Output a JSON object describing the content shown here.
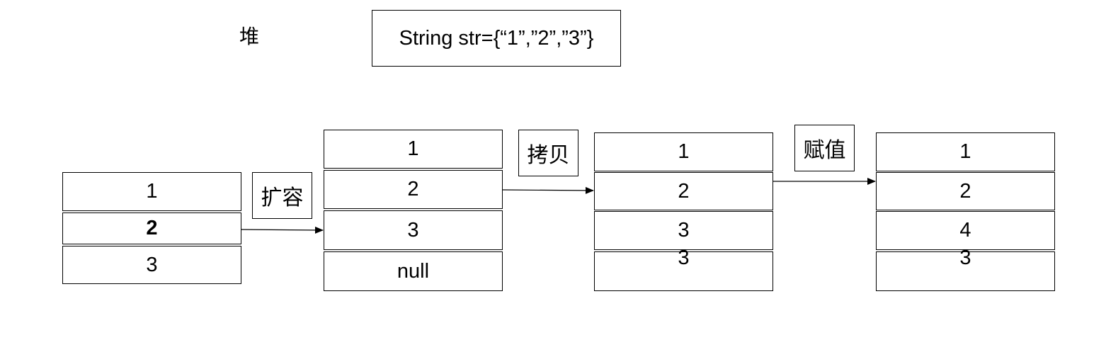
{
  "heap_label": "堆",
  "code": "String str={“1”,”2”,”3”}",
  "operations": {
    "expand": "扩容",
    "copy": "拷贝",
    "assign": "赋值"
  },
  "arrays": [
    {
      "cells": [
        "1",
        "2",
        "3"
      ]
    },
    {
      "cells": [
        "1",
        "2",
        "3",
        "null"
      ]
    },
    {
      "cells": [
        "1",
        "2",
        "3",
        "3"
      ]
    },
    {
      "cells": [
        "1",
        "2",
        "4",
        "3"
      ]
    }
  ]
}
